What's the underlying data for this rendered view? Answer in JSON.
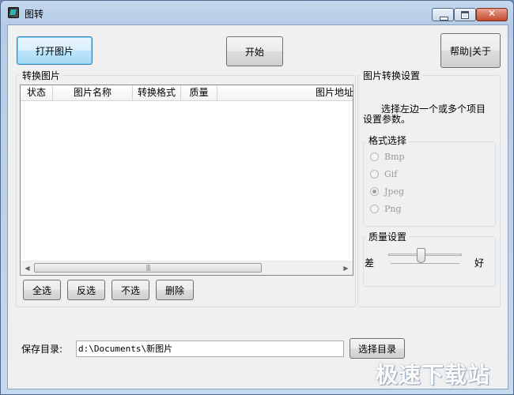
{
  "window": {
    "title": "图转",
    "icon": "image-convert-app-icon",
    "controls": [
      "minimize-icon",
      "maximize-icon",
      "close-icon"
    ]
  },
  "toolbar": {
    "open_label": "打开图片",
    "start_label": "开始",
    "help_label": "帮助|关于"
  },
  "convert_list": {
    "group_title": "转换图片",
    "columns": [
      "状态",
      "图片名称",
      "转换格式",
      "质量",
      "图片地址"
    ],
    "rows": []
  },
  "list_buttons": {
    "select_all": "全选",
    "invert": "反选",
    "select_none": "不选",
    "delete": "删除"
  },
  "settings": {
    "group_title": "图片转换设置",
    "hint_line1": "选择左边一个或多个项目",
    "hint_line2": "设置参数。",
    "format": {
      "title": "格式选择",
      "options": [
        "Bmp",
        "Gif",
        "Jpeg",
        "Png"
      ],
      "selected": "Jpeg",
      "enabled": false
    },
    "quality": {
      "title": "质量设置",
      "low_label": "差",
      "high_label": "好"
    }
  },
  "save": {
    "label": "保存目录:",
    "path": "d:\\Documents\\新图片",
    "browse_label": "选择目录"
  },
  "watermark": "极速下载站"
}
